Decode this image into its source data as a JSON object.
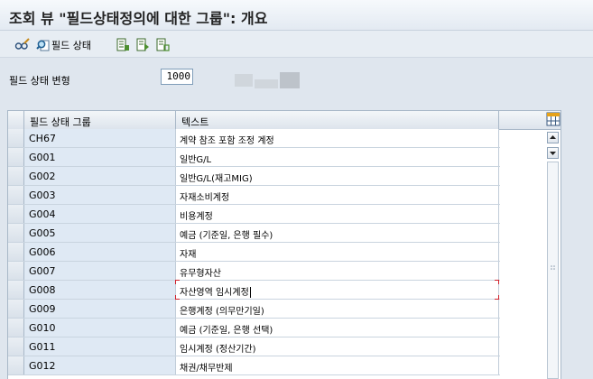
{
  "window": {
    "title": "조회 뷰 \"필드상태정의에 대한 그룹\": 개요"
  },
  "toolbar": {
    "field_status_label": "필드 상태"
  },
  "variant": {
    "label": "필드 상태 변형",
    "value": "1000"
  },
  "table": {
    "headers": {
      "group": "필드 상태 그룹",
      "text": "텍스트"
    },
    "rows": [
      {
        "group": "CH67",
        "text": "계약 참조 포함 조정 계정"
      },
      {
        "group": "G001",
        "text": "일반G/L"
      },
      {
        "group": "G002",
        "text": "일반G/L(재고MIG)"
      },
      {
        "group": "G003",
        "text": "자재소비계정"
      },
      {
        "group": "G004",
        "text": "비용계정"
      },
      {
        "group": "G005",
        "text": "예금 (기준일, 은행 필수)"
      },
      {
        "group": "G006",
        "text": "자재"
      },
      {
        "group": "G007",
        "text": "유무형자산"
      },
      {
        "group": "G008",
        "text": "자산영역 임시계정"
      },
      {
        "group": "G009",
        "text": "은행계정 (의무만기일)"
      },
      {
        "group": "G010",
        "text": "예금 (기준일, 은행 선택)"
      },
      {
        "group": "G011",
        "text": "임시계정 (정산기간)"
      },
      {
        "group": "G012",
        "text": "채권/채무반제"
      }
    ]
  },
  "colors": {
    "key_cell_bg": "#dfe9f4",
    "focus_marker": "#d0202a"
  }
}
